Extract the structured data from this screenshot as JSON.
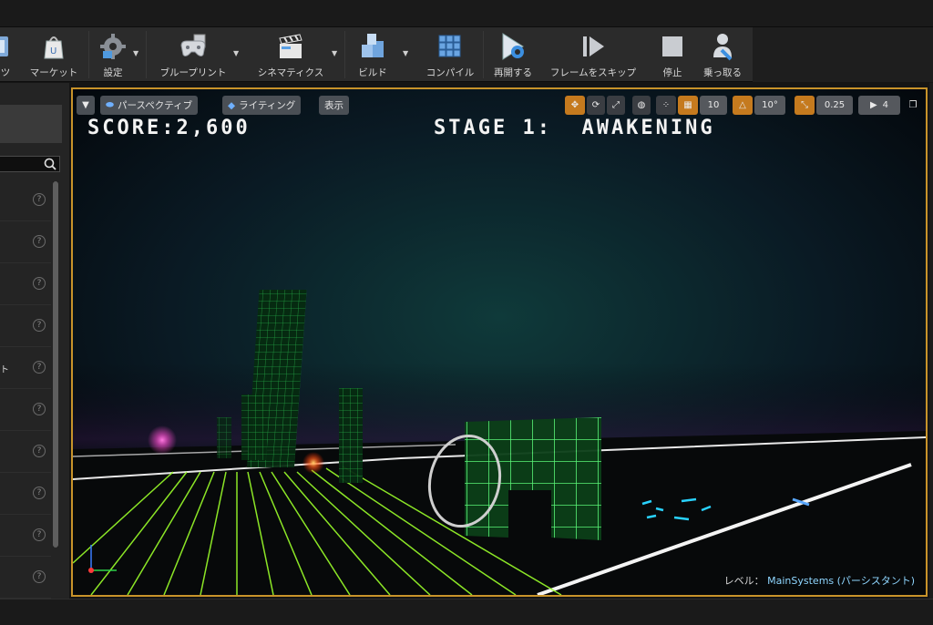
{
  "toolbar": {
    "buttons": [
      {
        "label": "ツ"
      },
      {
        "label": "マーケット"
      },
      {
        "label": "設定"
      },
      {
        "label": "ブループリント"
      },
      {
        "label": "シネマティクス"
      },
      {
        "label": "ビルド"
      },
      {
        "label": "コンパイル"
      },
      {
        "label": "再開する"
      },
      {
        "label": "フレームをスキップ"
      },
      {
        "label": "停止"
      },
      {
        "label": "乗っ取る"
      }
    ]
  },
  "left_panel": {
    "row_tick": "ト",
    "help_glyph": "?"
  },
  "viewport": {
    "perspective_label": "パースペクティブ",
    "lighting_label": "ライティング",
    "show_label": "表示",
    "grid_snap_value": "10",
    "rotation_snap_value": "10°",
    "scale_snap_value": "0.25",
    "camera_speed_value": "4",
    "hud": {
      "score": "SCORE:2,600",
      "stage": "STAGE 1:  AWAKENING"
    },
    "level_prefix": "レベル：",
    "level_name": "MainSystems (パーシスタント)"
  },
  "colors": {
    "accent": "#c8932a",
    "neon_green": "#3cff5a",
    "neon_pink": "#ff4fd2",
    "neon_cyan": "#29d3ff"
  }
}
